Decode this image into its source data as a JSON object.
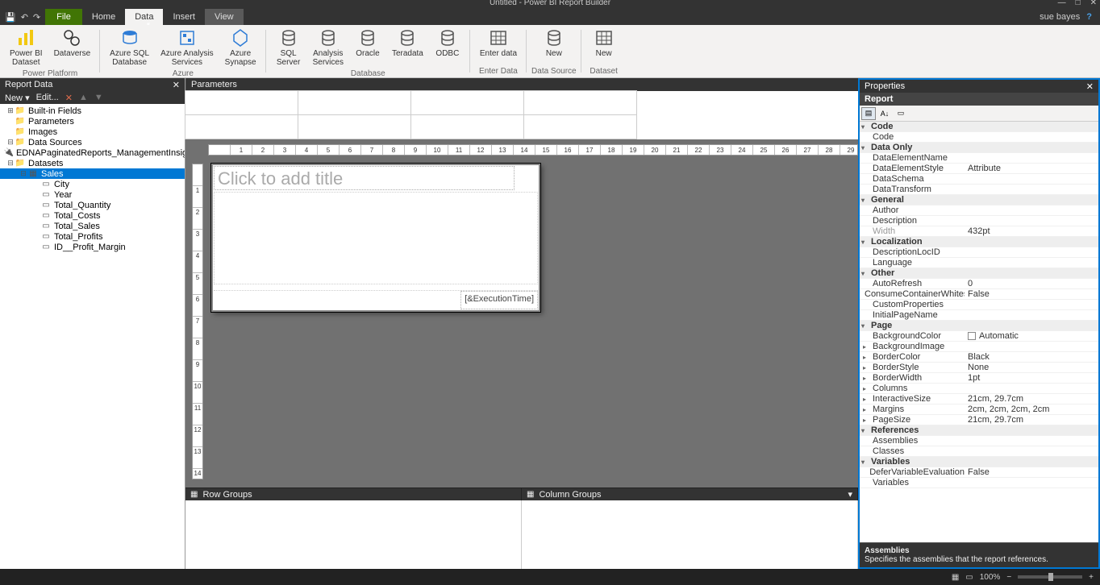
{
  "app_title": "Untitled - Power BI Report Builder",
  "user": "sue bayes",
  "tabs": {
    "file": "File",
    "home": "Home",
    "data": "Data",
    "insert": "Insert",
    "view": "View"
  },
  "ribbon": {
    "groups": [
      {
        "label": "Power Platform",
        "items": [
          {
            "label": "Power BI\nDataset",
            "icon": "pbi"
          },
          {
            "label": "Dataverse",
            "icon": "dv"
          }
        ]
      },
      {
        "label": "Azure",
        "items": [
          {
            "label": "Azure SQL\nDatabase",
            "icon": "azsql"
          },
          {
            "label": "Azure Analysis\nServices",
            "icon": "azas"
          },
          {
            "label": "Azure\nSynapse",
            "icon": "synapse"
          }
        ]
      },
      {
        "label": "Database",
        "items": [
          {
            "label": "SQL\nServer",
            "icon": "db"
          },
          {
            "label": "Analysis\nServices",
            "icon": "db"
          },
          {
            "label": "Oracle",
            "icon": "db"
          },
          {
            "label": "Teradata",
            "icon": "db"
          },
          {
            "label": "ODBC",
            "icon": "db"
          }
        ]
      },
      {
        "label": "Enter Data",
        "items": [
          {
            "label": "Enter data",
            "icon": "grid"
          }
        ]
      },
      {
        "label": "Data Source",
        "items": [
          {
            "label": "New",
            "icon": "db"
          }
        ]
      },
      {
        "label": "Dataset",
        "items": [
          {
            "label": "New",
            "icon": "grid"
          }
        ]
      }
    ]
  },
  "report_data": {
    "title": "Report Data",
    "toolbar": {
      "new": "New",
      "edit": "Edit..."
    },
    "nodes": [
      {
        "label": "Built-in Fields",
        "icon": "folder",
        "depth": 0,
        "exp": "+"
      },
      {
        "label": "Parameters",
        "icon": "folder",
        "depth": 0,
        "exp": " "
      },
      {
        "label": "Images",
        "icon": "folder",
        "depth": 0,
        "exp": " "
      },
      {
        "label": "Data Sources",
        "icon": "folder",
        "depth": 0,
        "exp": "-"
      },
      {
        "label": "EDNAPaginatedReports_ManagementInsights",
        "icon": "dsrc",
        "depth": 1,
        "exp": " "
      },
      {
        "label": "Datasets",
        "icon": "folder",
        "depth": 0,
        "exp": "-"
      },
      {
        "label": "Sales",
        "icon": "dset",
        "depth": 1,
        "exp": "-",
        "selected": true
      },
      {
        "label": "City",
        "icon": "fld",
        "depth": 2,
        "exp": " "
      },
      {
        "label": "Year",
        "icon": "fld",
        "depth": 2,
        "exp": " "
      },
      {
        "label": "Total_Quantity",
        "icon": "fld",
        "depth": 2,
        "exp": " "
      },
      {
        "label": "Total_Costs",
        "icon": "fld",
        "depth": 2,
        "exp": " "
      },
      {
        "label": "Total_Sales",
        "icon": "fld",
        "depth": 2,
        "exp": " "
      },
      {
        "label": "Total_Profits",
        "icon": "fld",
        "depth": 2,
        "exp": " "
      },
      {
        "label": "ID__Profit_Margin",
        "icon": "fld",
        "depth": 2,
        "exp": " "
      }
    ]
  },
  "parameters_title": "Parameters",
  "design": {
    "title_placeholder": "Click to add title",
    "footer_exec": "[&ExecutionTime]"
  },
  "groups": {
    "row": "Row Groups",
    "col": "Column Groups"
  },
  "properties": {
    "title": "Properties",
    "object": "Report",
    "rows": [
      {
        "type": "cat",
        "k": "Code"
      },
      {
        "type": "prop",
        "k": "Code",
        "v": ""
      },
      {
        "type": "cat",
        "k": "Data Only"
      },
      {
        "type": "prop",
        "k": "DataElementName",
        "v": ""
      },
      {
        "type": "prop",
        "k": "DataElementStyle",
        "v": "Attribute"
      },
      {
        "type": "prop",
        "k": "DataSchema",
        "v": ""
      },
      {
        "type": "prop",
        "k": "DataTransform",
        "v": ""
      },
      {
        "type": "cat",
        "k": "General"
      },
      {
        "type": "prop",
        "k": "Author",
        "v": ""
      },
      {
        "type": "prop",
        "k": "Description",
        "v": ""
      },
      {
        "type": "prop",
        "k": "Width",
        "v": "432pt",
        "dim": true
      },
      {
        "type": "cat",
        "k": "Localization"
      },
      {
        "type": "prop",
        "k": "DescriptionLocID",
        "v": ""
      },
      {
        "type": "prop",
        "k": "Language",
        "v": ""
      },
      {
        "type": "cat",
        "k": "Other"
      },
      {
        "type": "prop",
        "k": "AutoRefresh",
        "v": "0"
      },
      {
        "type": "prop",
        "k": "ConsumeContainerWhitespace",
        "v": "False"
      },
      {
        "type": "prop",
        "k": "CustomProperties",
        "v": ""
      },
      {
        "type": "prop",
        "k": "InitialPageName",
        "v": ""
      },
      {
        "type": "cat",
        "k": "Page"
      },
      {
        "type": "prop",
        "k": "BackgroundColor",
        "v": "Automatic",
        "swatch": true
      },
      {
        "type": "prop",
        "k": "BackgroundImage",
        "v": "",
        "expand": true
      },
      {
        "type": "prop",
        "k": "BorderColor",
        "v": "Black",
        "expand": true
      },
      {
        "type": "prop",
        "k": "BorderStyle",
        "v": "None",
        "expand": true
      },
      {
        "type": "prop",
        "k": "BorderWidth",
        "v": "1pt",
        "expand": true
      },
      {
        "type": "prop",
        "k": "Columns",
        "v": "",
        "expand": true
      },
      {
        "type": "prop",
        "k": "InteractiveSize",
        "v": "21cm, 29.7cm",
        "expand": true
      },
      {
        "type": "prop",
        "k": "Margins",
        "v": "2cm, 2cm, 2cm, 2cm",
        "expand": true
      },
      {
        "type": "prop",
        "k": "PageSize",
        "v": "21cm, 29.7cm",
        "expand": true
      },
      {
        "type": "cat",
        "k": "References"
      },
      {
        "type": "prop",
        "k": "Assemblies",
        "v": ""
      },
      {
        "type": "prop",
        "k": "Classes",
        "v": ""
      },
      {
        "type": "cat",
        "k": "Variables"
      },
      {
        "type": "prop",
        "k": "DeferVariableEvaluation",
        "v": "False"
      },
      {
        "type": "prop",
        "k": "Variables",
        "v": ""
      }
    ],
    "help_title": "Assemblies",
    "help_text": "Specifies the assemblies that the report references."
  },
  "status": {
    "zoom": "100%"
  }
}
